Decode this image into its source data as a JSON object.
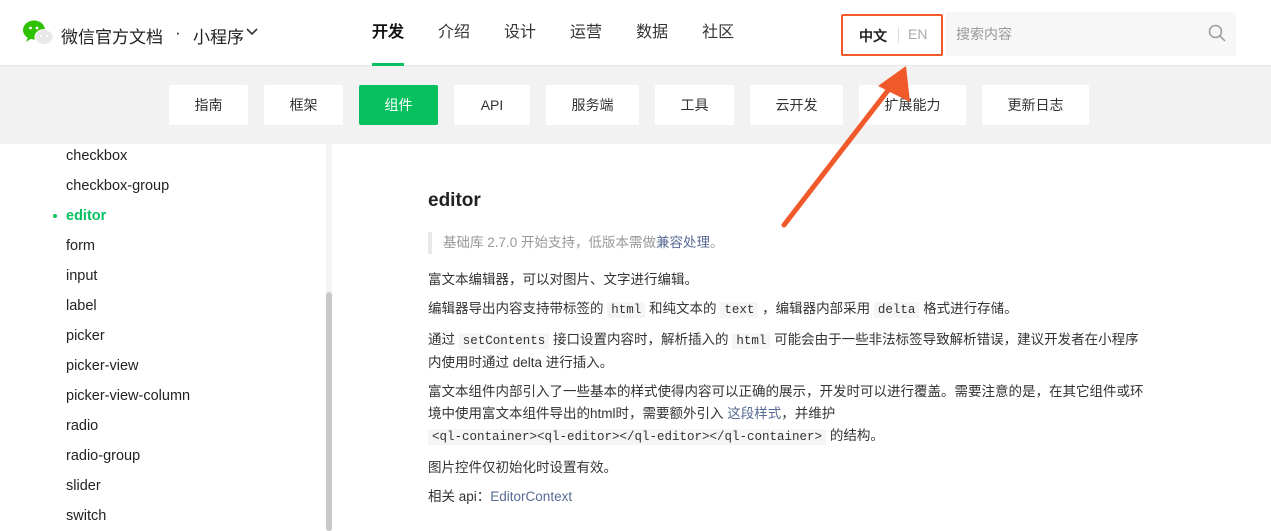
{
  "header": {
    "brand": "微信官方文档",
    "dot": "·",
    "product": "小程序",
    "nav": [
      "开发",
      "介绍",
      "设计",
      "运营",
      "数据",
      "社区"
    ],
    "lang_zh": "中文",
    "lang_en": "EN",
    "search_placeholder": "搜索内容"
  },
  "subnav": [
    "指南",
    "框架",
    "组件",
    "API",
    "服务端",
    "工具",
    "云开发",
    "扩展能力",
    "更新日志"
  ],
  "sidebar": {
    "items": [
      "checkbox",
      "checkbox-group",
      "editor",
      "form",
      "input",
      "label",
      "picker",
      "picker-view",
      "picker-view-column",
      "radio",
      "radio-group",
      "slider",
      "switch"
    ],
    "active": "editor"
  },
  "content": {
    "title": "editor",
    "quote_prefix": "基础库 2.7.0 开始支持，低版本需做",
    "quote_link": "兼容处理",
    "quote_suffix": "。",
    "p1": "富文本编辑器，可以对图片、文字进行编辑。",
    "p2_a": "编辑器导出内容支持带标签的",
    "p2_code1": "html",
    "p2_b": "和纯文本的",
    "p2_code2": "text",
    "p2_c": "，编辑器内部采用",
    "p2_code3": "delta",
    "p2_d": "格式进行存储。",
    "p3_a": "通过",
    "p3_code1": "setContents",
    "p3_b": "接口设置内容时，解析插入的",
    "p3_code2": "html",
    "p3_c": "可能会由于一些非法标签导致解析错误，建议开发者在小程序内使用时通过 delta 进行插入。",
    "p4_a": "富文本组件内部引入了一些基本的样式使得内容可以正确的展示，开发时可以进行覆盖。需要注意的是，在其它组件或环境中使用富文本组件导出的html时，需要额外引入",
    "p4_link": "这段样式",
    "p4_b": "，并维护",
    "p4_code": "<ql-container><ql-editor></ql-editor></ql-container>",
    "p4_c": "的结构。",
    "p5": "图片控件仅初始化时设置有效。",
    "p6_label": "相关 api：",
    "p6_link": "EditorContext"
  },
  "colors": {
    "accent": "#07c160",
    "highlight": "#f05a2a",
    "link": "#576b95"
  }
}
